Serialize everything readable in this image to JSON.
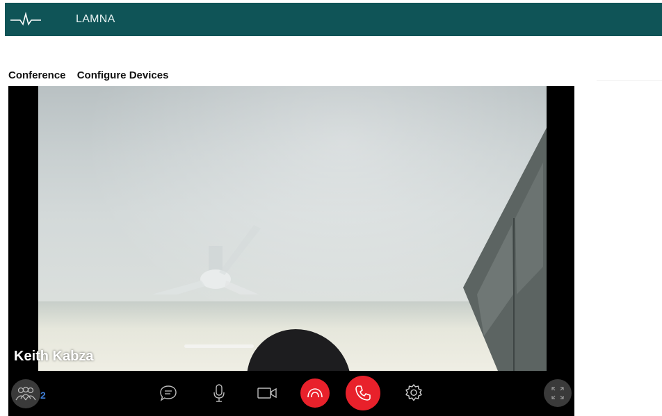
{
  "app": {
    "brand": "LAMNA"
  },
  "tabs": [
    {
      "label": "Conference"
    },
    {
      "label": "Configure Devices"
    }
  ],
  "video": {
    "participant_name": "Keith Kabza"
  },
  "controls": {
    "participant_count": "2",
    "icons": [
      "participants-icon",
      "chat-icon",
      "microphone-icon",
      "camera-icon",
      "hold-icon",
      "call-icon",
      "settings-icon",
      "fullscreen-icon"
    ],
    "accent_red": "#e8212b",
    "count_color": "#3f7ed6"
  },
  "colors": {
    "header": "#0f5457"
  }
}
